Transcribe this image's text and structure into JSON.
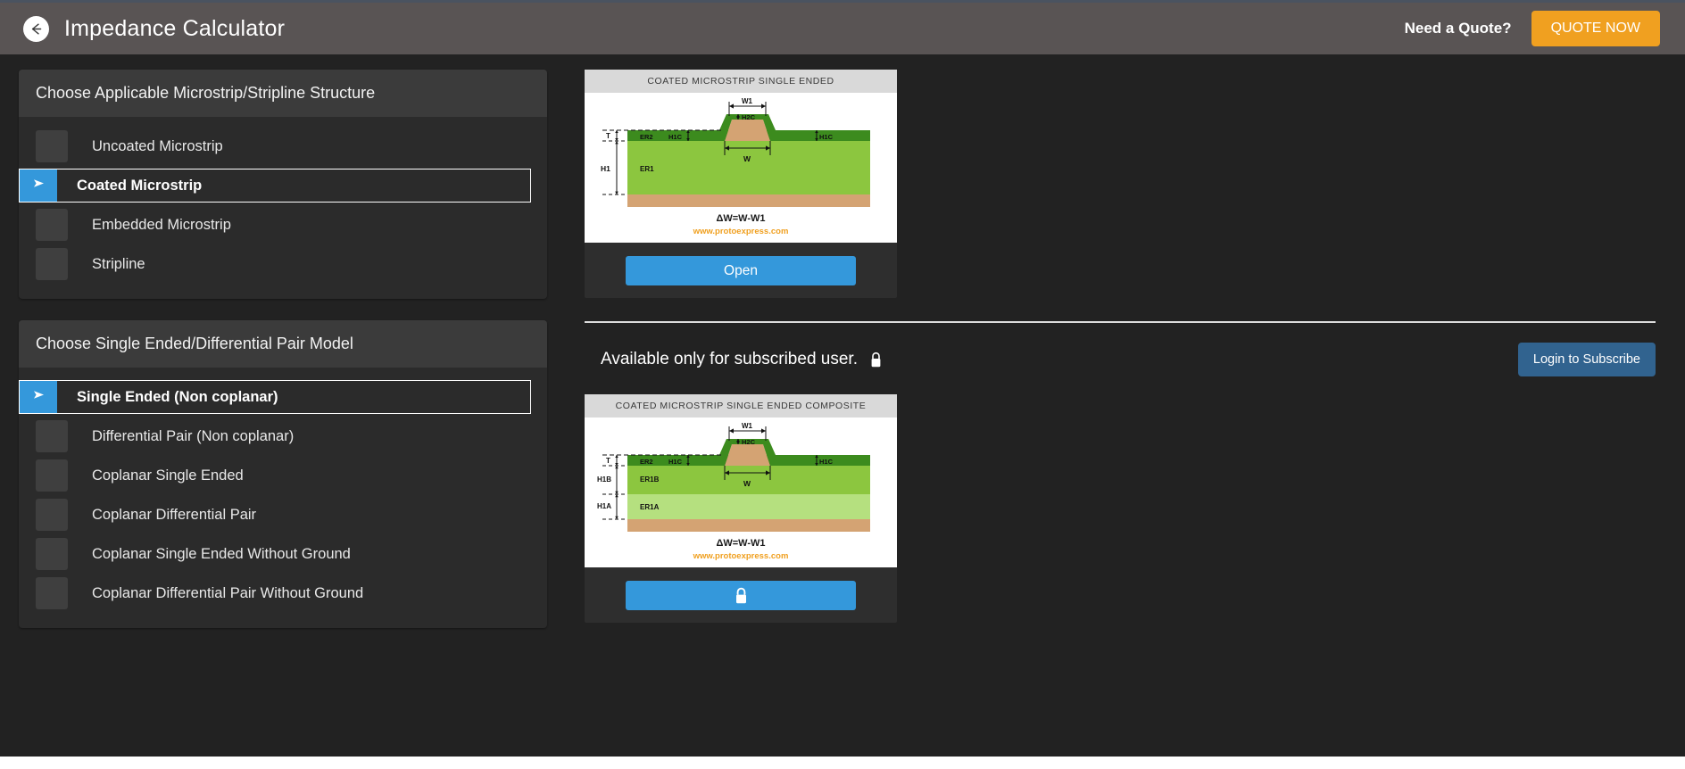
{
  "header": {
    "back_icon": "arrow-left-icon",
    "title": "Impedance Calculator",
    "need_quote_label": "Need a Quote?",
    "quote_button_label": "QUOTE NOW",
    "quote_button_color": "#f0a020",
    "bar_color": "#595454"
  },
  "structure_panel": {
    "heading": "Choose Applicable Microstrip/Stripline Structure",
    "options": [
      {
        "label": "Uncoated Microstrip",
        "selected": false
      },
      {
        "label": "Coated Microstrip",
        "selected": true
      },
      {
        "label": "Embedded Microstrip",
        "selected": false
      },
      {
        "label": "Stripline",
        "selected": false
      }
    ]
  },
  "model_panel": {
    "heading": "Choose Single Ended/Differential Pair Model",
    "options": [
      {
        "label": "Single Ended (Non coplanar)",
        "selected": true
      },
      {
        "label": "Differential Pair (Non coplanar)",
        "selected": false
      },
      {
        "label": "Coplanar Single Ended",
        "selected": false
      },
      {
        "label": "Coplanar Differential Pair",
        "selected": false
      },
      {
        "label": "Coplanar Single Ended Without Ground",
        "selected": false
      },
      {
        "label": "Coplanar Differential Pair Without Ground",
        "selected": false
      }
    ]
  },
  "free_card": {
    "figure_title": "COATED MICROSTRIP SINGLE ENDED",
    "labels": {
      "w1": "W1",
      "h2c": "H2C",
      "t": "T",
      "er2": "ER2",
      "h1c_left": "H1C",
      "h1c_right": "H1C",
      "w": "W",
      "h1": "H1",
      "er1": "ER1",
      "formula": "ΔW=W-W1",
      "watermark": "www.protoexpress.com"
    },
    "button_label": "Open",
    "button_color": "#3498db"
  },
  "subscription": {
    "message": "Available only for subscribed user.",
    "lock_icon": "lock-icon",
    "login_button_label": "Login to Subscribe",
    "login_button_color": "#31638f"
  },
  "locked_card": {
    "figure_title": "COATED MICROSTRIP SINGLE ENDED COMPOSITE",
    "labels": {
      "w1": "W1",
      "h2c": "H2C",
      "t": "T",
      "er2": "ER2",
      "h1c_left": "H1C",
      "h1c_right": "H1C",
      "w": "W",
      "h1b": "H1B",
      "er1b": "ER1B",
      "h1a": "H1A",
      "er1a": "ER1A",
      "formula": "ΔW=W-W1",
      "watermark": "www.protoexpress.com"
    },
    "button_icon": "lock-icon",
    "button_color": "#3498db"
  },
  "palette": {
    "page_background": "#222222",
    "panel_background": "#2b2b2b",
    "panel_head_background": "#3b3b3b",
    "accent_blue": "#3498db",
    "dielectric_light": "#8cc63f",
    "soldermask_dark": "#3c8b1e",
    "copper": "#d4a373",
    "watermark_color": "#f0a020"
  }
}
